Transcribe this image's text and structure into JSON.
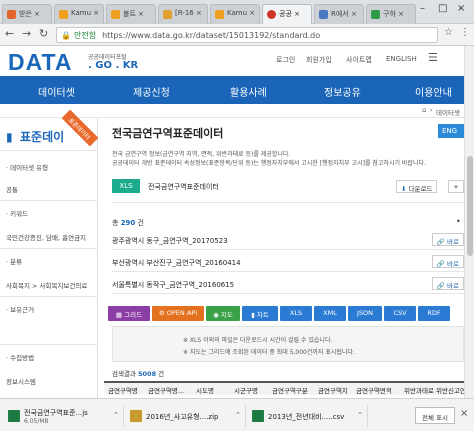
{
  "browser": {
    "tabs": [
      {
        "label": "받은 ×"
      },
      {
        "label": "Kamu ×"
      },
      {
        "label": "볼트 ×"
      },
      {
        "label": "[R-16 ×"
      },
      {
        "label": "Kamu ×"
      },
      {
        "label": "공공 ×"
      },
      {
        "label": "R에서 ×"
      },
      {
        "label": "구하 ×"
      }
    ],
    "secure_label": "안전함",
    "url": "https://www.data.go.kr/dataset/15013192/standard.do"
  },
  "site": {
    "logo": "DATA",
    "logo_sub1": "공공데이터포털",
    "logo_sub2": ". GO . KR",
    "top_links": [
      "로그인",
      "회원가입",
      "사이트맵",
      "ENGLISH"
    ],
    "menu": [
      "데이터셋",
      "제공신청",
      "활용사례",
      "정보공유",
      "이용안내"
    ],
    "breadcrumb": "데이터셋"
  },
  "sidebar": {
    "title": "표준데이",
    "ribbon": "표준데이터",
    "items": [
      "· 데이터셋 유형",
      "공통",
      "· 키워드",
      "국민건강증진, 담배, 흡연금지",
      "· 분류",
      "사회복지 > 사회복지보건의료",
      "· 보유근거",
      "· 수집방법",
      "정보시스템"
    ]
  },
  "main": {
    "title": "전국금연구역표준데이터",
    "eng_button": "ENG",
    "desc_line1": "전국 금연구역 정보(금연구역 지역, 면적, 위반과태료 등)를 제공합니다.",
    "desc_line2": "공공데이터 개방 표준데이터 속성정보(표준항목/단위 등)는 행정자치부에서 고시한 [행정자치부 고시]를 참고하시기 바랍니다.",
    "file_badge": "XLS",
    "file_name": "전국금연구역표준데이터",
    "download_button": "다운로드",
    "plus_button": "+",
    "total_prefix": "총",
    "total_count": "290",
    "total_suffix": "건",
    "datasets": [
      {
        "title": "광주광역시 동구_금연구역_20170523",
        "button": "바로"
      },
      {
        "title": "부산광역시 부산진구_금연구역_20160414",
        "button": "바로"
      },
      {
        "title": "서울특별시 동작구_금연구역_20160615",
        "button": "바로"
      }
    ],
    "formats": [
      {
        "label": "그리드",
        "color": "#8a3ea6"
      },
      {
        "label": "OPEN API",
        "color": "#e3711f"
      },
      {
        "label": "지도",
        "color": "#3aa246"
      },
      {
        "label": "차트",
        "color": "#2b7bd4"
      },
      {
        "label": "XLS",
        "color": "#2b7bd4"
      },
      {
        "label": "XML",
        "color": "#2b7bd4"
      },
      {
        "label": "JSON",
        "color": "#2b7bd4"
      },
      {
        "label": "CSV",
        "color": "#2b7bd4"
      },
      {
        "label": "RDF",
        "color": "#2b7bd4"
      }
    ],
    "notice_line1": "※ XLS 이외의 파일은 다운로드시 시간이 걸릴 수 있습니다.",
    "notice_line2": "※ 지도는 그리드에 조회된 데이터 중 최대 5,000건까지 표시됩니다.",
    "result_prefix": "검색결과",
    "result_count": "5008",
    "result_suffix": "건",
    "columns": [
      "금연구역명",
      "금연구역명...",
      "시도명",
      "시군구명",
      "금연구역구분",
      "금연구역지",
      "금연구역면적",
      "위반과태료",
      "위반신고연..."
    ]
  },
  "downloads": {
    "items": [
      {
        "name": "전국금연구역표준...js",
        "size": "6.05/MB"
      },
      {
        "name": "2016년_사고유형....zip",
        "size": ""
      },
      {
        "name": "2013년_전년대비.....csv",
        "size": ""
      }
    ],
    "show_all": "전체 표시"
  }
}
